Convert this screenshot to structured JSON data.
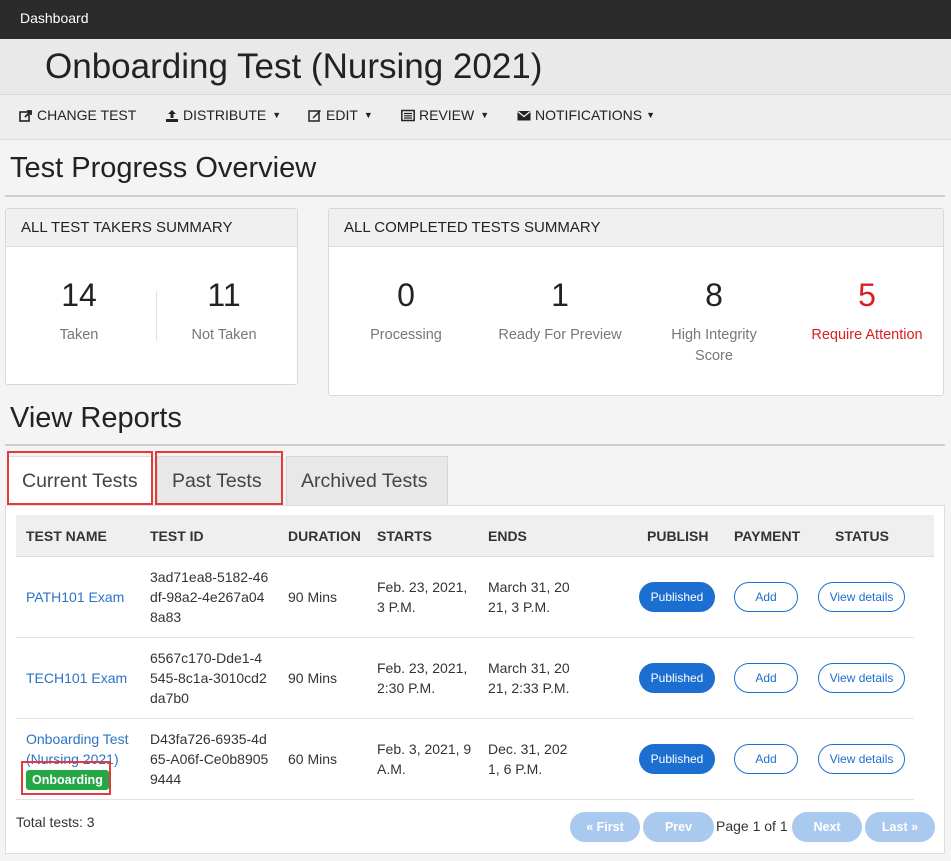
{
  "app": {
    "dashboard_label": "Dashboard"
  },
  "page": {
    "title": "Onboarding Test (Nursing 2021)"
  },
  "menu": {
    "change_test": "CHANGE TEST",
    "distribute": "DISTRIBUTE",
    "edit": "EDIT",
    "review": "REVIEW",
    "notifications": "NOTIFICATIONS"
  },
  "overview": {
    "title": "Test Progress Overview"
  },
  "takers_summary": {
    "title": "ALL TEST TAKERS SUMMARY",
    "taken_value": "14",
    "taken_label": "Taken",
    "not_taken_value": "11",
    "not_taken_label": "Not Taken"
  },
  "completed_summary": {
    "title": "ALL COMPLETED TESTS SUMMARY",
    "processing_value": "0",
    "processing_label": "Processing",
    "ready_value": "1",
    "ready_label": "Ready For Preview",
    "integrity_value": "8",
    "integrity_label_1": "High Integrity",
    "integrity_label_2": "Score",
    "attention_value": "5",
    "attention_label": "Require Attention",
    "attention_color": "#d92020"
  },
  "reports": {
    "title": "View Reports"
  },
  "tabs": [
    {
      "label": "Current Tests",
      "active": true
    },
    {
      "label": "Past Tests",
      "active": false
    },
    {
      "label": "Archived Tests",
      "active": false
    }
  ],
  "table": {
    "headers": {
      "name": "TEST NAME",
      "id": "TEST ID",
      "duration": "DURATION",
      "starts": "STARTS",
      "ends": "ENDS",
      "publish": "PUBLISH",
      "payment": "PAYMENT",
      "status": "STATUS"
    },
    "rows": [
      {
        "name_1": "PATH101 Exam",
        "id_1": "3ad71ea8-5182-46",
        "id_2": "df-98a2-4e267a04",
        "id_3": "8a83",
        "duration": "90 Mins",
        "starts_1": "Feb. 23, 2021,",
        "starts_2": "3 P.M.",
        "ends_1": "March 31, 20",
        "ends_2": "21, 3 P.M.",
        "publish": "Published",
        "payment": "Add",
        "status": "View details"
      },
      {
        "name_1": "TECH101 Exam",
        "id_1": "6567c170-Dde1-4",
        "id_2": "545-8c1a-3010cd2",
        "id_3": "da7b0",
        "duration": "90 Mins",
        "starts_1": "Feb. 23, 2021,",
        "starts_2": "2:30 P.M.",
        "ends_1": "March 31, 20",
        "ends_2": "21, 2:33 P.M.",
        "publish": "Published",
        "payment": "Add",
        "status": "View details"
      },
      {
        "name_1": "Onboarding Test",
        "name_2": "(Nursing 2021)",
        "badge": "Onboarding",
        "id_1": "D43fa726-6935-4d",
        "id_2": "65-A06f-Ce0b8905",
        "id_3": "9444",
        "duration": "60 Mins",
        "starts_1": "Feb. 3, 2021, 9",
        "starts_2": "A.M.",
        "ends_1": "Dec. 31, 202",
        "ends_2": "1, 6 P.M.",
        "publish": "Published",
        "payment": "Add",
        "status": "View details"
      }
    ]
  },
  "footer": {
    "total": "Total tests: 3",
    "first": "« First",
    "prev": "Prev",
    "page_info": "Page 1 of 1",
    "next": "Next",
    "last": "Last »"
  },
  "colors": {
    "topbar": "#2b2b2b",
    "link": "#2a73c5",
    "primary": "#1c6fd1",
    "badge": "#25a745",
    "highlight": "#e53a3a"
  }
}
